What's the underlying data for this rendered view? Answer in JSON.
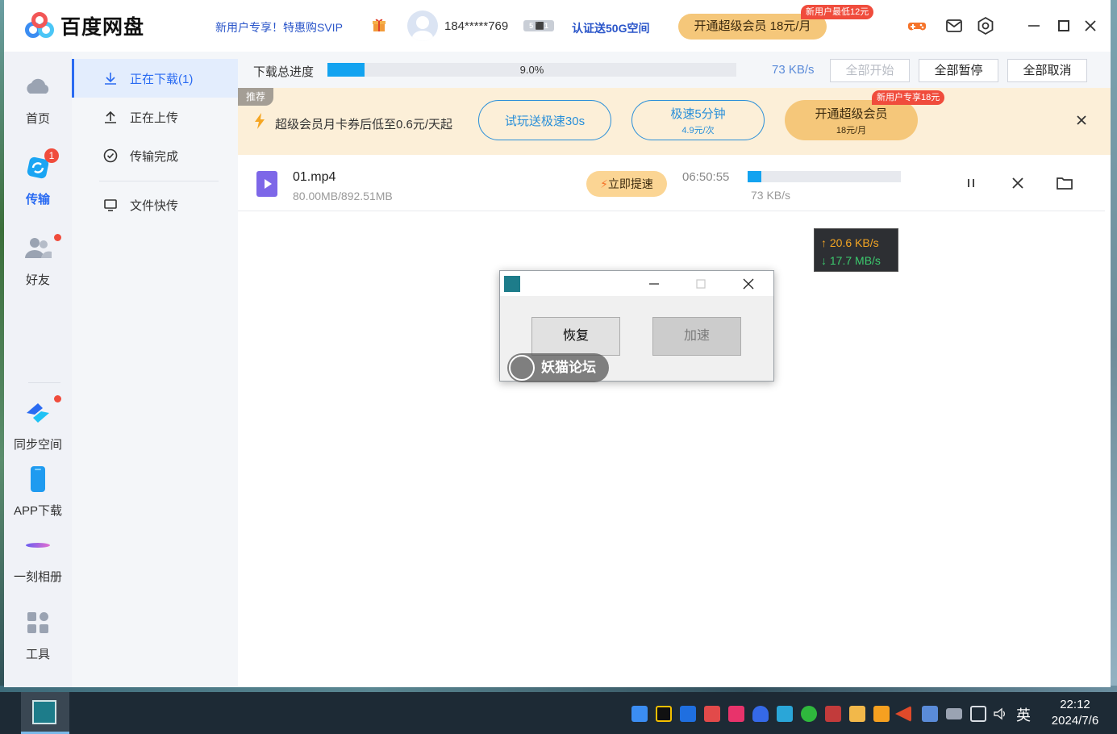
{
  "header": {
    "app_name": "百度网盘",
    "promo_link": "新用户专享！特惠购SVIP",
    "username": "184*****769",
    "vip_badge": "5 ⬛1",
    "verify_link": "认证送50G空间",
    "open_vip_label": "开通超级会员 18元/月",
    "open_vip_tag": "新用户最低12元"
  },
  "leftnav": {
    "items": [
      {
        "label": "首页"
      },
      {
        "label": "传输",
        "badge": "1"
      },
      {
        "label": "好友"
      },
      {
        "label": "同步空间"
      },
      {
        "label": "APP下载"
      },
      {
        "label": "一刻相册"
      },
      {
        "label": "工具"
      }
    ]
  },
  "subnav": {
    "items": [
      {
        "label": "正在下载(1)"
      },
      {
        "label": "正在上传"
      },
      {
        "label": "传输完成"
      },
      {
        "label": "文件快传"
      }
    ]
  },
  "progress": {
    "label": "下载总进度",
    "percent_text": "9.0%",
    "percent": 9.0,
    "speed": "73 KB/s",
    "start_all": "全部开始",
    "pause_all": "全部暂停",
    "cancel_all": "全部取消"
  },
  "banner": {
    "tag": "推荐",
    "text": "超级会员月卡券后低至0.6元/天起",
    "trial_label": "试玩送极速30s",
    "fast_label": "极速5分钟",
    "fast_price": "4.9元/次",
    "vip_label": "开通超级会员",
    "vip_price": "18元/月",
    "new_user_tag": "新用户专享18元"
  },
  "download": {
    "file_name": "01.mp4",
    "size": "80.00MB/892.51MB",
    "boost_label": "立即提速",
    "eta": "06:50:55",
    "progress_fraction": 0.0896,
    "speed": "73 KB/s"
  },
  "speed_widget": {
    "up": "↑ 20.6 KB/s",
    "down": "↓ 17.7 MB/s"
  },
  "dialog": {
    "resume_label": "恢复",
    "accelerate_label": "加速",
    "watermark": "妖猫论坛"
  },
  "taskbar": {
    "ime": "英",
    "time": "22:12",
    "date": "2024/7/6"
  },
  "colors": {
    "accent": "#2a6bf2",
    "progress": "#13a3f0",
    "vip_gold": "#f5c77a",
    "badge_red": "#f04c3c",
    "banner_bg": "#fcefd8"
  }
}
